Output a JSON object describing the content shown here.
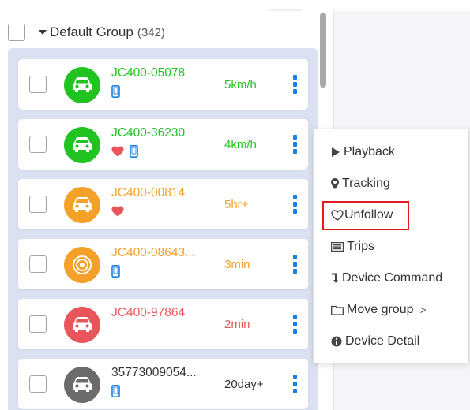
{
  "group": {
    "name": "Default Group",
    "count": "(342)"
  },
  "devices": [
    {
      "name": "JC400-05078",
      "status": "5km/h",
      "color": "#21c321",
      "avatar": "car",
      "heart": false,
      "phone": true
    },
    {
      "name": "JC400-36230",
      "status": "4km/h",
      "color": "#21c321",
      "avatar": "car",
      "heart": true,
      "phone": true
    },
    {
      "name": "JC400-00814",
      "status": "5hr+",
      "color": "#f5a028",
      "avatar": "car",
      "heart": true,
      "phone": false
    },
    {
      "name": "JC400-08643...",
      "status": "3min",
      "color": "#f5a028",
      "avatar": "target",
      "heart": false,
      "phone": true
    },
    {
      "name": "JC400-97864",
      "status": "2min",
      "color": "#e8565b",
      "avatar": "car",
      "heart": false,
      "phone": false
    },
    {
      "name": "35773009054...",
      "status": "20day+",
      "color": "#6b6b6b",
      "avatar": "car",
      "heart": false,
      "phone": true
    }
  ],
  "menu": {
    "items": [
      {
        "label": "Playback",
        "icon": "play-icon"
      },
      {
        "label": "Tracking",
        "icon": "map-pin-icon"
      },
      {
        "label": "Unfollow",
        "icon": "heart-outline-icon"
      },
      {
        "label": "Trips",
        "icon": "list-icon"
      },
      {
        "label": "Device Command",
        "icon": "command-arrow-icon"
      },
      {
        "label": "Move group",
        "icon": "folder-icon",
        "submenu_arrow": ">"
      },
      {
        "label": "Device Detail",
        "icon": "info-icon"
      }
    ],
    "highlighted": "Unfollow",
    "highlight_color": "#e21b1b"
  },
  "colors": {
    "online_green": "#21c321",
    "idle_orange": "#f5a028",
    "alert_red": "#e8565b",
    "offline_gray": "#6b6b6b",
    "accent_blue": "#1a7fe0",
    "heart_red": "#e8565b",
    "list_background": "#dbe1f0"
  }
}
